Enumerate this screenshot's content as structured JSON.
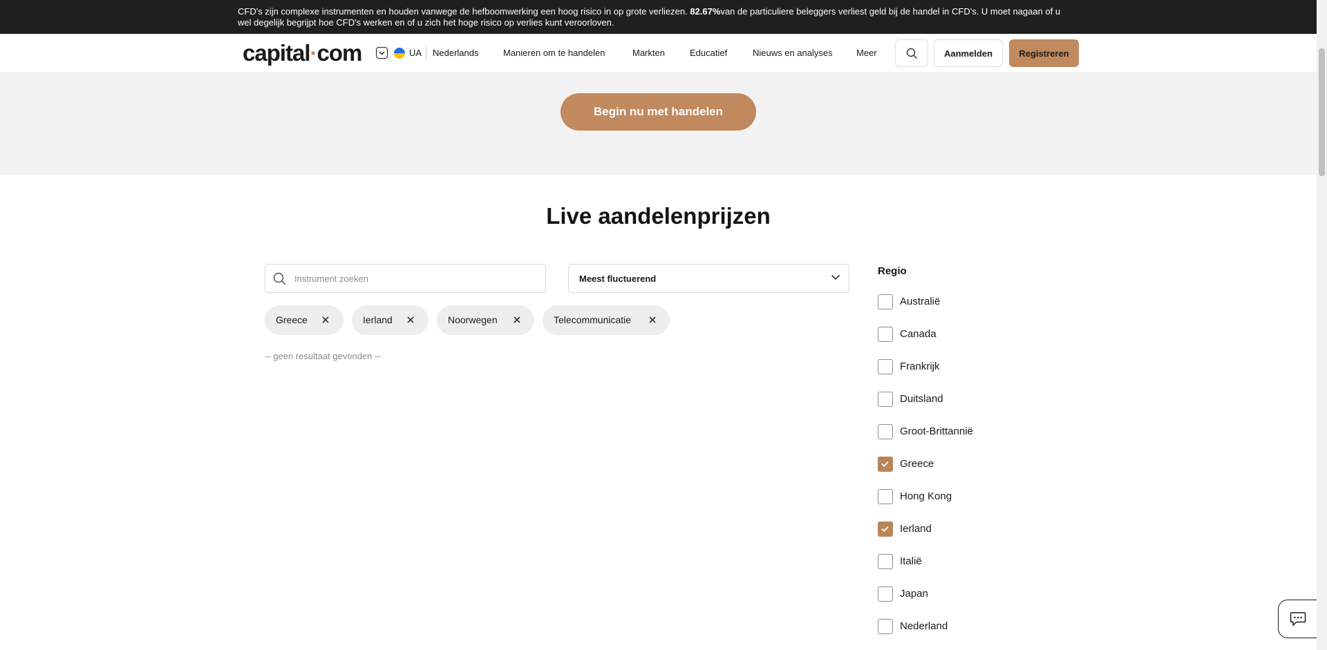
{
  "risk_banner": {
    "text_before": "CFD's zijn complexe instrumenten en houden vanwege de hefboomwerking een hoog risico in op grote verliezen. ",
    "percentage": "82.67%",
    "text_after": "van de particuliere beleggers verliest geld bij de handel in CFD's. U moet nagaan of u wel degelijk begrijpt hoe CFD's werken en of u zich het hoge risico op verlies kunt veroorloven."
  },
  "header": {
    "logo_main": "capital",
    "logo_dot": "·",
    "logo_end": "com",
    "country_code": "UA",
    "language": "Nederlands",
    "nav": [
      "Manieren om te handelen",
      "Markten",
      "Educatief",
      "Nieuws en analyses",
      "Meer"
    ],
    "login_label": "Aanmelden",
    "register_label": "Registreren"
  },
  "hero": {
    "cta_label": "Begin nu met handelen"
  },
  "main": {
    "title": "Live aandelenprijzen",
    "search_placeholder": "Instrument zoeken",
    "sort_value": "Meest fluctuerend",
    "filter_chips": [
      "Greece",
      "Ierland",
      "Noorwegen",
      "Telecommunicatie"
    ],
    "no_results": "-- geen resultaat gevonden --"
  },
  "region_filter": {
    "title": "Regio",
    "items": [
      {
        "label": "Australië",
        "checked": false
      },
      {
        "label": "Canada",
        "checked": false
      },
      {
        "label": "Frankrijk",
        "checked": false
      },
      {
        "label": "Duitsland",
        "checked": false
      },
      {
        "label": "Groot-Brittannië",
        "checked": false
      },
      {
        "label": "Greece",
        "checked": true
      },
      {
        "label": "Hong Kong",
        "checked": false
      },
      {
        "label": "Ierland",
        "checked": true
      },
      {
        "label": "Italië",
        "checked": false
      },
      {
        "label": "Japan",
        "checked": false
      },
      {
        "label": "Nederland",
        "checked": false
      }
    ]
  },
  "colors": {
    "accent": "#c0895e",
    "checkbox_checked": "#b98458",
    "banner_bg": "#1f1f1f",
    "hero_bg": "#f2f2f2"
  },
  "icons": {
    "search": "search-icon",
    "chevron": "chevron-down-icon",
    "close": "close-icon",
    "check": "check-icon",
    "chat": "chat-icon"
  }
}
